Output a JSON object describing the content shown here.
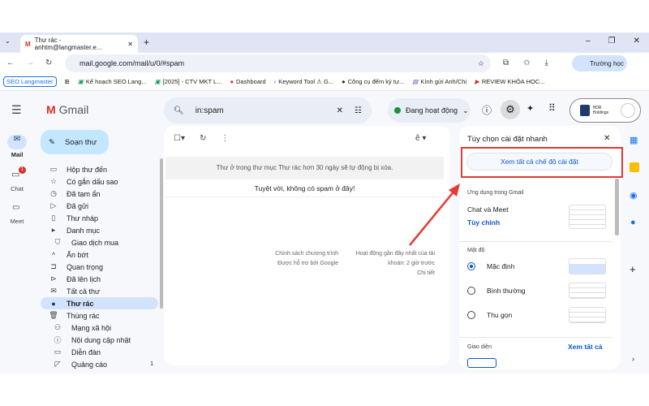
{
  "browser": {
    "tab_title": "Thư rác - anhtm@langmaster.e...",
    "url": "mail.google.com/mail/u/0/#spam",
    "profile": "Trường học",
    "bookmarks": [
      "SEO Langmaster",
      "Kế hoạch SEO Lang...",
      "[2025] - CTV MKT L...",
      "Dashboard",
      "Keyword Tool ⚠ G...",
      "Công cụ đếm ký tự...",
      "Kính gửi Anh/Chị",
      "REVIEW KHÓA HỌC..."
    ]
  },
  "gmail": {
    "logo": "Gmail",
    "search_value": "in:spam",
    "status": "Đang hoạt động",
    "account_label": "HDR Holdings",
    "rail": [
      {
        "label": "Mail"
      },
      {
        "label": "Chat",
        "badge": "1"
      },
      {
        "label": "Meet"
      }
    ],
    "compose": "Soạn thư",
    "nav": [
      {
        "label": "Hộp thư đến",
        "icon": "▭"
      },
      {
        "label": "Có gắn dấu sao",
        "icon": "☆"
      },
      {
        "label": "Đã tạm ẩn",
        "icon": "◷"
      },
      {
        "label": "Đã gửi",
        "icon": "▷"
      },
      {
        "label": "Thư nháp",
        "icon": "▯"
      },
      {
        "label": "Danh mục",
        "icon": "▸"
      },
      {
        "label": "Giao dịch mua",
        "icon": "⛉"
      },
      {
        "label": "Ẩn bớt",
        "icon": "^"
      },
      {
        "label": "Quan trọng",
        "icon": "⊐"
      },
      {
        "label": "Đã lên lịch",
        "icon": "⊳"
      },
      {
        "label": "Tất cả thư",
        "icon": "✉"
      },
      {
        "label": "Thư rác",
        "icon": "●"
      },
      {
        "label": "Thùng rác",
        "icon": "🗑"
      },
      {
        "label": "Mạng xã hội",
        "icon": "⚇"
      },
      {
        "label": "Nội dung cập nhật",
        "icon": "ⓘ"
      },
      {
        "label": "Diễn đàn",
        "icon": "▭"
      },
      {
        "label": "Quảng cáo",
        "icon": "◸",
        "count": "1"
      }
    ],
    "main": {
      "notice": "Thư ở trong thư mục Thư rác hơn 30 ngày sẽ tự động bị xóa.",
      "empty": "Tuyệt vời, không có spam ở đây!",
      "footer_left": [
        "Chính sách chương trình",
        "Được hỗ trợ bởi Google"
      ],
      "footer_right": [
        "Hoạt động gần đây nhất của tài",
        "khoản: 2 giờ trước",
        "Chi tiết"
      ],
      "input_tool": "ê"
    },
    "quick_settings": {
      "title": "Tùy chọn cài đặt nhanh",
      "see_all_settings": "Xem tất cả chế độ cài đặt",
      "apps_heading": "Ứng dụng trong Gmail",
      "chat_meet": "Chat và Meet",
      "customize": "Tùy chỉnh",
      "density_heading": "Mật độ",
      "density": [
        {
          "label": "Mặc định",
          "selected": true
        },
        {
          "label": "Bình thường",
          "selected": false
        },
        {
          "label": "Thu gọn",
          "selected": false
        }
      ],
      "theme_heading": "Giao diện",
      "see_all": "Xem tất cả"
    }
  },
  "colors": {
    "accent": "#0b57d0",
    "highlight": "#e53935",
    "selected_nav": "#d3e3fd"
  }
}
